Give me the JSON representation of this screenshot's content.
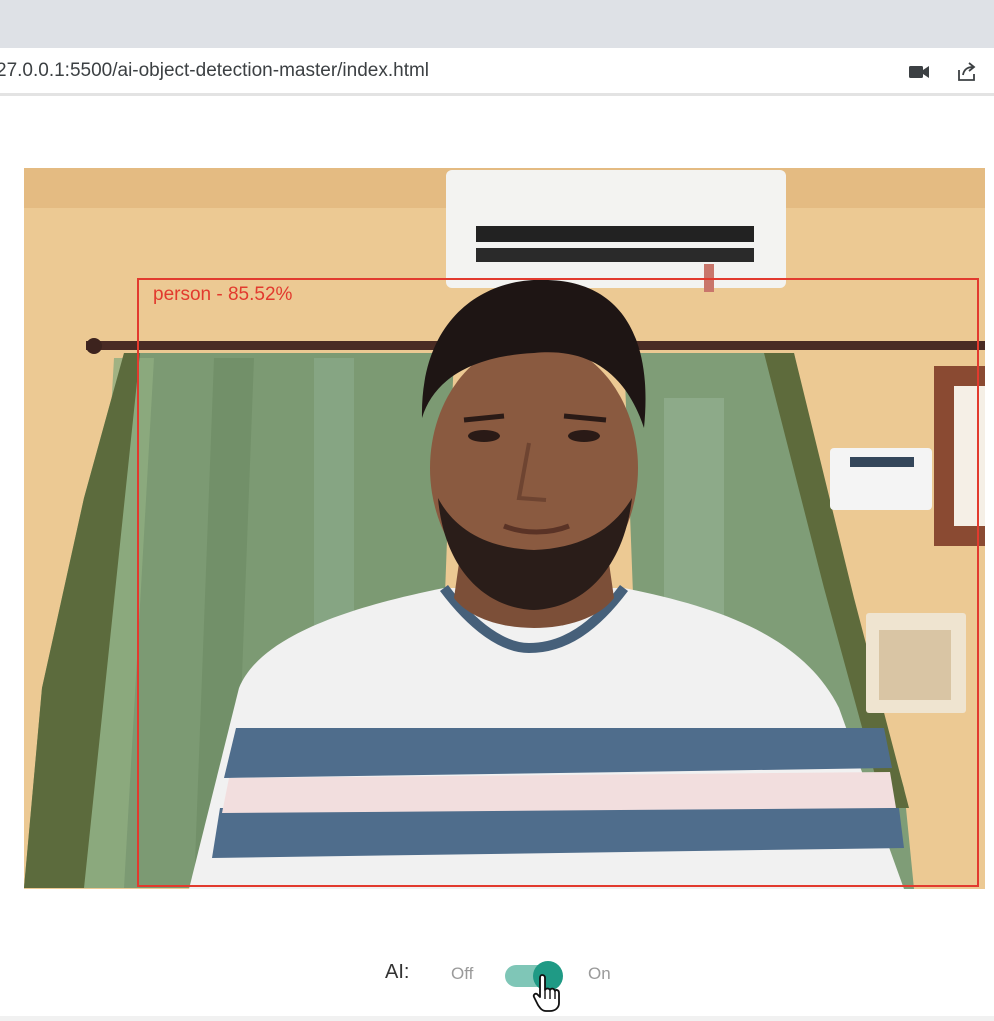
{
  "browser": {
    "url": "27.0.0.1:5500/ai-object-detection-master/index.html",
    "icons": [
      "video-camera-icon",
      "share-icon"
    ]
  },
  "detection": {
    "label": "person - 85.52%",
    "box_color": "#e23a2e"
  },
  "controls": {
    "ai_label": "AI:",
    "off_label": "Off",
    "on_label": "On",
    "toggle_state": "on",
    "toggle_color": "#1f9a85"
  }
}
